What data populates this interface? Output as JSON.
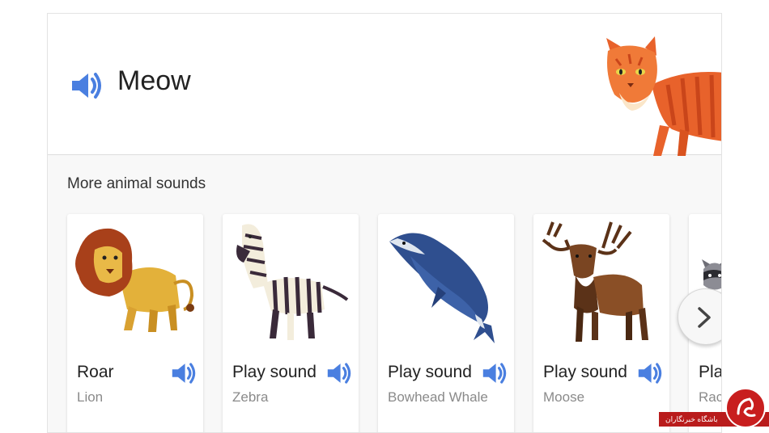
{
  "hero": {
    "title": "Meow",
    "speaker_icon": "volume-icon",
    "image": "cat-illustration"
  },
  "section": {
    "title": "More animal sounds"
  },
  "animals": [
    {
      "label": "Roar",
      "name": "Lion",
      "icon": "volume-icon"
    },
    {
      "label": "Play sound",
      "name": "Zebra",
      "icon": "volume-icon"
    },
    {
      "label": "Play sound",
      "name": "Bowhead Whale",
      "icon": "volume-icon"
    },
    {
      "label": "Play sound",
      "name": "Moose",
      "icon": "volume-icon"
    },
    {
      "label": "Pla",
      "name": "Rac",
      "icon": "volume-icon"
    }
  ],
  "carousel": {
    "next_icon": "chevron-right-icon"
  },
  "watermark": {
    "text": "باشگاه خبرنگاران"
  },
  "colors": {
    "accent": "#4a7fe0",
    "background": "#f8f8f8",
    "card": "#ffffff"
  }
}
